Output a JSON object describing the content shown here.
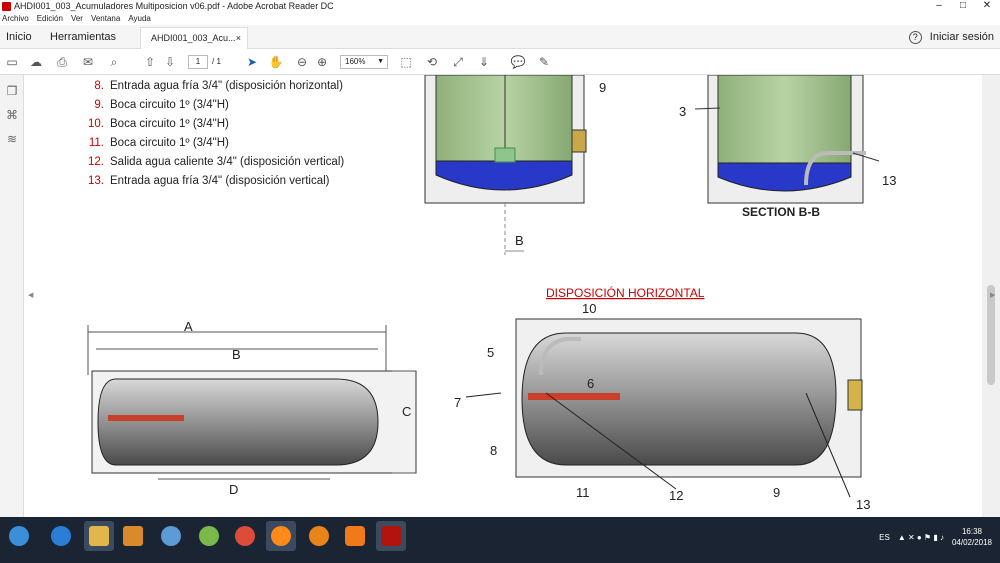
{
  "window": {
    "title": "AHDI001_003_Acumuladores Multiposicion v06.pdf - Adobe Acrobat Reader DC"
  },
  "menu": [
    "Archivo",
    "Edición",
    "Ver",
    "Ventana",
    "Ayuda"
  ],
  "nav": {
    "home": "Inicio",
    "tools": "Herramientas",
    "doc_tab": "AHDI001_003_Acu...",
    "close_tab": "×",
    "help": "?",
    "signin": "Iniciar sesión"
  },
  "toolbar": {
    "page_current": "1",
    "page_total": "/ 1",
    "zoom": "160%"
  },
  "items": [
    {
      "n": "8.",
      "text": "Entrada agua fría 3/4\" (disposición horizontal)"
    },
    {
      "n": "9.",
      "text": "Boca circuito 1º (3/4\"H)"
    },
    {
      "n": "10.",
      "text": "Boca circuito 1º (3/4\"H)"
    },
    {
      "n": "11.",
      "text": "Boca circuito 1º (3/4\"H)"
    },
    {
      "n": "12.",
      "text": "Salida agua caliente 3/4\" (disposición vertical)"
    },
    {
      "n": "13.",
      "text": "Entrada agua fría 3/4\" (disposición vertical)"
    }
  ],
  "drawing": {
    "label_9_top": "9",
    "label_3": "3",
    "label_13_top": "13",
    "section": "SECTION B-B",
    "label_B_top": "B",
    "heading": "DISPOSICIÓN HORIZONTAL",
    "dim_A": "A",
    "dim_B": "B",
    "dim_C": "C",
    "dim_D": "D",
    "c5": "5",
    "c6": "6",
    "c7": "7",
    "c8": "8",
    "c9": "9",
    "c10": "10",
    "c11": "11",
    "c12": "12",
    "c13": "13"
  },
  "taskbar": {
    "lang": "ES",
    "time": "16:38",
    "date": "04/02/2018"
  }
}
